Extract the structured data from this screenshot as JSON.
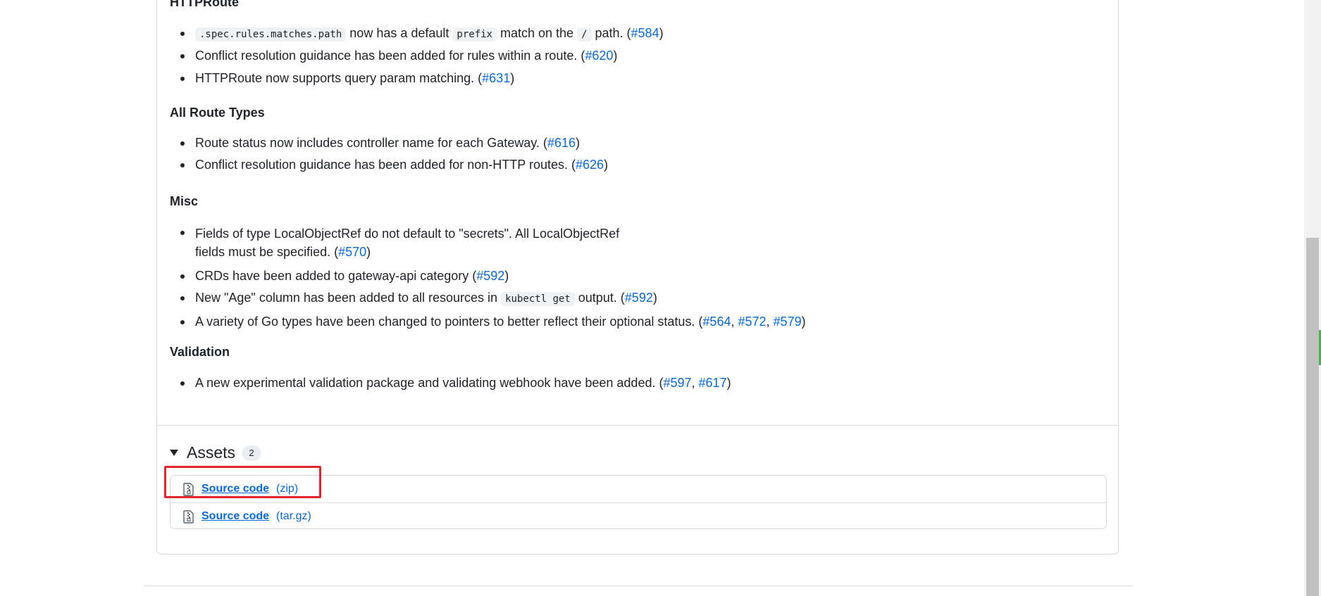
{
  "sections": [
    {
      "heading": "HTTPRoute",
      "items": [
        {
          "pre": "",
          "code": ".spec.rules.matches.path",
          "mid": " now has a default ",
          "code2": "prefix",
          "mid2": " match on the ",
          "code3": "/",
          "post": " path. (",
          "links": [
            "#584"
          ],
          "end": ")"
        },
        {
          "text": "Conflict resolution guidance has been added for rules within a route. (",
          "links": [
            "#620"
          ],
          "end": ")"
        },
        {
          "text": "HTTPRoute now supports query param matching. (",
          "links": [
            "#631"
          ],
          "end": ")"
        }
      ]
    },
    {
      "heading": "All Route Types",
      "items": [
        {
          "text": "Route status now includes controller name for each Gateway. (",
          "links": [
            "#616"
          ],
          "end": ")"
        },
        {
          "text": "Conflict resolution guidance has been added for non-HTTP routes. (",
          "links": [
            "#626"
          ],
          "end": ")"
        }
      ]
    },
    {
      "heading": "Misc",
      "items": [
        {
          "line1": "Fields of type LocalObjectRef do not default to \"secrets\". All LocalObjectRef",
          "line2": "fields must be specified. (",
          "links": [
            "#570"
          ],
          "end": ")"
        },
        {
          "text": "CRDs have been added to gateway-api category (",
          "links": [
            "#592"
          ],
          "end": ")"
        },
        {
          "pre": "New \"Age\" column has been added to all resources in ",
          "code": "kubectl get",
          "post": " output. (",
          "links": [
            "#592"
          ],
          "end": ")"
        },
        {
          "text": "A variety of Go types have been changed to pointers to better reflect their optional status. (",
          "links": [
            "#564",
            "#572",
            "#579"
          ],
          "sep": ", ",
          "end": ")"
        }
      ]
    },
    {
      "heading": "Validation",
      "items": [
        {
          "text": "A new experimental validation package and validating webhook have been added. (",
          "links": [
            "#597",
            "#617"
          ],
          "sep": ", ",
          "end": ")"
        }
      ]
    }
  ],
  "assets": {
    "title": "Assets",
    "count": "2",
    "items": [
      {
        "name": "Source code",
        "ext": "(zip)",
        "icon": "file-zip-icon"
      },
      {
        "name": "Source code",
        "ext": "(tar.gz)",
        "icon": "file-zip-icon"
      }
    ]
  },
  "colors": {
    "link": "#0969da",
    "highlight": "#e0262c"
  }
}
